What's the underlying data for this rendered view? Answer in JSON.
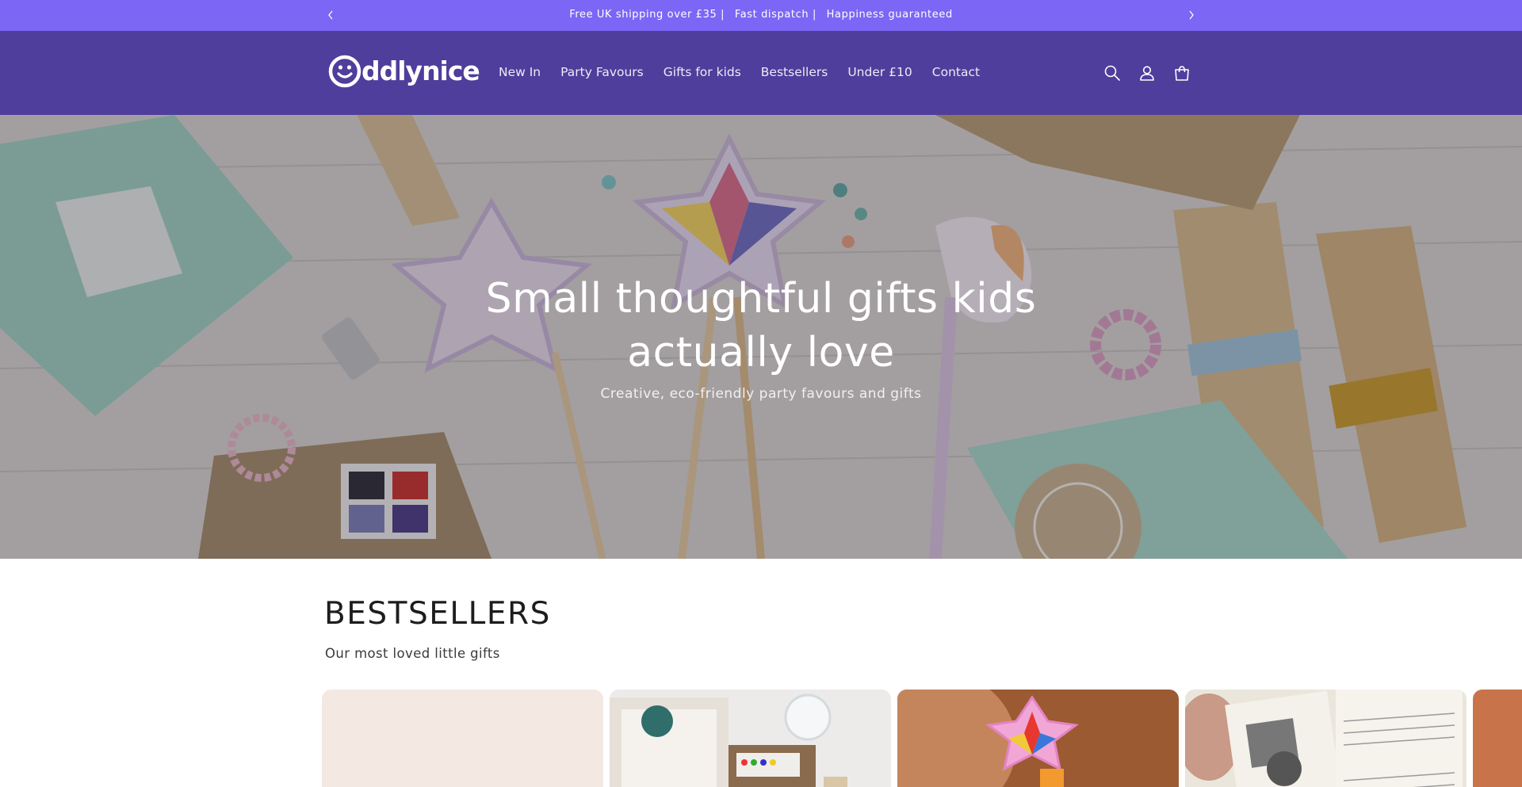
{
  "announcement": {
    "prev_label": "Previous announcement",
    "next_label": "Next announcement",
    "items": [
      "Free UK shipping over £35 |",
      "Fast dispatch |",
      "Happiness guaranteed"
    ],
    "background": "#7b66f5"
  },
  "header": {
    "logo_text": "ddlynice",
    "logo_aria": "Oddlynice",
    "background": "#4f3e9b",
    "nav": [
      "New In",
      "Party Favours",
      "Gifts for kids",
      "Bestsellers",
      "Under £10",
      "Contact"
    ],
    "icons": [
      "search-icon",
      "account-icon",
      "cart-icon"
    ]
  },
  "hero": {
    "title_line1": "Small thoughtful gifts kids",
    "title_line2": "actually love",
    "subtitle": "Creative, eco-friendly party favours and gifts"
  },
  "bestsellers": {
    "title": "BESTSELLERS",
    "subtitle": "Our most loved little gifts",
    "cards": [
      {
        "name": "product-card-1"
      },
      {
        "name": "product-card-2"
      },
      {
        "name": "product-card-3"
      },
      {
        "name": "product-card-4"
      },
      {
        "name": "product-card-5"
      }
    ]
  }
}
